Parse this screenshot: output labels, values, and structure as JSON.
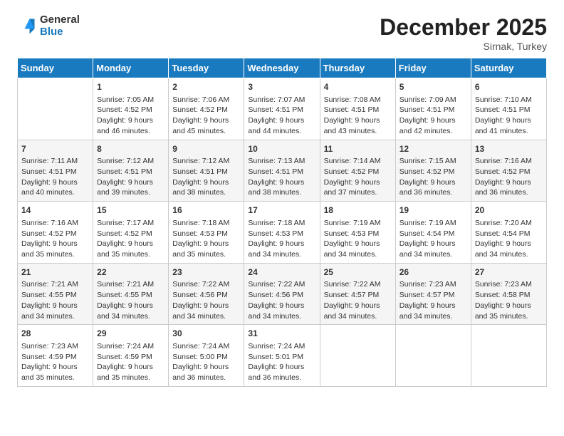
{
  "header": {
    "logo": {
      "general": "General",
      "blue": "Blue"
    },
    "title": "December 2025",
    "location": "Sirnak, Turkey"
  },
  "days_of_week": [
    "Sunday",
    "Monday",
    "Tuesday",
    "Wednesday",
    "Thursday",
    "Friday",
    "Saturday"
  ],
  "weeks": [
    [
      {
        "day": "",
        "info": ""
      },
      {
        "day": "1",
        "info": "Sunrise: 7:05 AM\nSunset: 4:52 PM\nDaylight: 9 hours and 46 minutes."
      },
      {
        "day": "2",
        "info": "Sunrise: 7:06 AM\nSunset: 4:52 PM\nDaylight: 9 hours and 45 minutes."
      },
      {
        "day": "3",
        "info": "Sunrise: 7:07 AM\nSunset: 4:51 PM\nDaylight: 9 hours and 44 minutes."
      },
      {
        "day": "4",
        "info": "Sunrise: 7:08 AM\nSunset: 4:51 PM\nDaylight: 9 hours and 43 minutes."
      },
      {
        "day": "5",
        "info": "Sunrise: 7:09 AM\nSunset: 4:51 PM\nDaylight: 9 hours and 42 minutes."
      },
      {
        "day": "6",
        "info": "Sunrise: 7:10 AM\nSunset: 4:51 PM\nDaylight: 9 hours and 41 minutes."
      }
    ],
    [
      {
        "day": "7",
        "info": "Sunrise: 7:11 AM\nSunset: 4:51 PM\nDaylight: 9 hours and 40 minutes."
      },
      {
        "day": "8",
        "info": "Sunrise: 7:12 AM\nSunset: 4:51 PM\nDaylight: 9 hours and 39 minutes."
      },
      {
        "day": "9",
        "info": "Sunrise: 7:12 AM\nSunset: 4:51 PM\nDaylight: 9 hours and 38 minutes."
      },
      {
        "day": "10",
        "info": "Sunrise: 7:13 AM\nSunset: 4:51 PM\nDaylight: 9 hours and 38 minutes."
      },
      {
        "day": "11",
        "info": "Sunrise: 7:14 AM\nSunset: 4:52 PM\nDaylight: 9 hours and 37 minutes."
      },
      {
        "day": "12",
        "info": "Sunrise: 7:15 AM\nSunset: 4:52 PM\nDaylight: 9 hours and 36 minutes."
      },
      {
        "day": "13",
        "info": "Sunrise: 7:16 AM\nSunset: 4:52 PM\nDaylight: 9 hours and 36 minutes."
      }
    ],
    [
      {
        "day": "14",
        "info": "Sunrise: 7:16 AM\nSunset: 4:52 PM\nDaylight: 9 hours and 35 minutes."
      },
      {
        "day": "15",
        "info": "Sunrise: 7:17 AM\nSunset: 4:52 PM\nDaylight: 9 hours and 35 minutes."
      },
      {
        "day": "16",
        "info": "Sunrise: 7:18 AM\nSunset: 4:53 PM\nDaylight: 9 hours and 35 minutes."
      },
      {
        "day": "17",
        "info": "Sunrise: 7:18 AM\nSunset: 4:53 PM\nDaylight: 9 hours and 34 minutes."
      },
      {
        "day": "18",
        "info": "Sunrise: 7:19 AM\nSunset: 4:53 PM\nDaylight: 9 hours and 34 minutes."
      },
      {
        "day": "19",
        "info": "Sunrise: 7:19 AM\nSunset: 4:54 PM\nDaylight: 9 hours and 34 minutes."
      },
      {
        "day": "20",
        "info": "Sunrise: 7:20 AM\nSunset: 4:54 PM\nDaylight: 9 hours and 34 minutes."
      }
    ],
    [
      {
        "day": "21",
        "info": "Sunrise: 7:21 AM\nSunset: 4:55 PM\nDaylight: 9 hours and 34 minutes."
      },
      {
        "day": "22",
        "info": "Sunrise: 7:21 AM\nSunset: 4:55 PM\nDaylight: 9 hours and 34 minutes."
      },
      {
        "day": "23",
        "info": "Sunrise: 7:22 AM\nSunset: 4:56 PM\nDaylight: 9 hours and 34 minutes."
      },
      {
        "day": "24",
        "info": "Sunrise: 7:22 AM\nSunset: 4:56 PM\nDaylight: 9 hours and 34 minutes."
      },
      {
        "day": "25",
        "info": "Sunrise: 7:22 AM\nSunset: 4:57 PM\nDaylight: 9 hours and 34 minutes."
      },
      {
        "day": "26",
        "info": "Sunrise: 7:23 AM\nSunset: 4:57 PM\nDaylight: 9 hours and 34 minutes."
      },
      {
        "day": "27",
        "info": "Sunrise: 7:23 AM\nSunset: 4:58 PM\nDaylight: 9 hours and 35 minutes."
      }
    ],
    [
      {
        "day": "28",
        "info": "Sunrise: 7:23 AM\nSunset: 4:59 PM\nDaylight: 9 hours and 35 minutes."
      },
      {
        "day": "29",
        "info": "Sunrise: 7:24 AM\nSunset: 4:59 PM\nDaylight: 9 hours and 35 minutes."
      },
      {
        "day": "30",
        "info": "Sunrise: 7:24 AM\nSunset: 5:00 PM\nDaylight: 9 hours and 36 minutes."
      },
      {
        "day": "31",
        "info": "Sunrise: 7:24 AM\nSunset: 5:01 PM\nDaylight: 9 hours and 36 minutes."
      },
      {
        "day": "",
        "info": ""
      },
      {
        "day": "",
        "info": ""
      },
      {
        "day": "",
        "info": ""
      }
    ]
  ]
}
